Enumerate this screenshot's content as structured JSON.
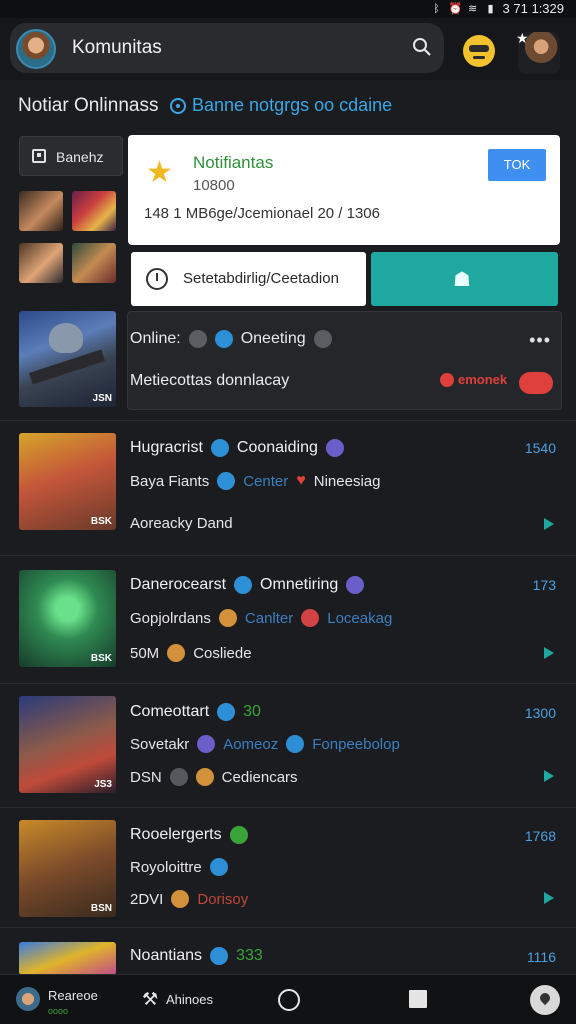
{
  "status_bar": {
    "time": "3 71 1:329"
  },
  "header": {
    "title": "Komunitas"
  },
  "section": {
    "title": "Notiar Onlinnass",
    "link": "Banne notgrgs  oo cdaine"
  },
  "sidebar": {
    "button_label": "Banehz"
  },
  "feature_badge": "JSN",
  "notification": {
    "title": "Notifiantas",
    "count": "10800",
    "body": "148 1 MB6ge/Jcemionael 20 / 1306",
    "button": "TOK"
  },
  "actions": {
    "primary": "Setetabdirlig/Ceetadion"
  },
  "online": {
    "label": "Online:",
    "tag": "Oneeting",
    "subtitle": "Metiecottas donnlacay",
    "badge": "emonek"
  },
  "items": [
    {
      "title": "Hugracrist",
      "tag": "Coonaiding",
      "line2": "Baya Fiants",
      "line2_status": "Center",
      "line2_extra": "Nineesiag",
      "line3": "Aoreacky Dand",
      "num": "1540",
      "badge": "BSK"
    },
    {
      "title": "Danerocearst",
      "tag": "Omnetiring",
      "line2": "Gopjolrdans",
      "line2_status": "Canlter",
      "line2_extra": "Loceakag",
      "line3": "50M",
      "line3_extra": "Cosliede",
      "num": "173",
      "badge": "BSK"
    },
    {
      "title": "Comeottart",
      "tag": "30",
      "line2": "Sovetakr",
      "line2_status": "Aomeoz",
      "line2_extra": "Fonpeebolop",
      "line3": "DSN",
      "line3_extra": "Cediencars",
      "num": "1300",
      "badge": "JS3"
    },
    {
      "title": "Rooelergerts",
      "tag": "",
      "line2": "Royoloittre",
      "line2_status": "",
      "line2_extra": "",
      "line3": "2DVI",
      "line3_extra": "Dorisoy",
      "num": "1768",
      "badge": "BSN"
    },
    {
      "title": "Noantians",
      "tag": "333",
      "num": "1116"
    }
  ],
  "bottom_nav": {
    "left_label": "Reareoe",
    "left_sub": "oooo",
    "tool_label": "Ahinoes"
  },
  "colors": {
    "accent": "#1fa8a0",
    "link": "#39a7e6",
    "danger": "#e0403b"
  }
}
